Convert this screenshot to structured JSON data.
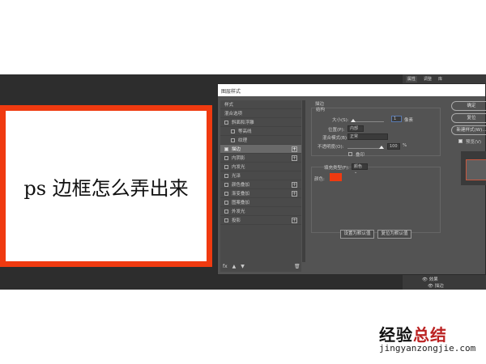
{
  "canvas": {
    "text": "ps 边框怎么弄出来",
    "border_color": "#f03a10"
  },
  "panel_tabs": [
    "属性",
    "调整",
    "库"
  ],
  "dialog": {
    "title": "图层样式",
    "styles": [
      {
        "label": "样式",
        "type": "header"
      },
      {
        "label": "混合选项",
        "type": "header"
      },
      {
        "label": "斜面和浮雕",
        "checked": false
      },
      {
        "label": "等高线",
        "checked": false,
        "sub": true
      },
      {
        "label": "纹理",
        "checked": false,
        "sub": true
      },
      {
        "label": "描边",
        "checked": true,
        "plus": true,
        "selected": true
      },
      {
        "label": "内阴影",
        "checked": false,
        "plus": true
      },
      {
        "label": "内发光",
        "checked": false
      },
      {
        "label": "光泽",
        "checked": false
      },
      {
        "label": "颜色叠加",
        "checked": false,
        "plus": true
      },
      {
        "label": "渐变叠加",
        "checked": false,
        "plus": true
      },
      {
        "label": "图案叠加",
        "checked": false
      },
      {
        "label": "外发光",
        "checked": false
      },
      {
        "label": "投影",
        "checked": false,
        "plus": true
      }
    ],
    "footer_icons": [
      "fx",
      "▲",
      "▼"
    ],
    "stroke": {
      "section": "描边",
      "structure": "结构",
      "size_label": "大小(S):",
      "size_value": "1",
      "size_unit": "像素",
      "size_fraction": 0.02,
      "position_label": "位置(P):",
      "position_value": "内部",
      "blend_label": "混合模式(B):",
      "blend_value": "正常",
      "opacity_label": "不透明度(O):",
      "opacity_value": "100",
      "opacity_unit": "%",
      "opacity_fraction": 1.0,
      "overprint_label": "叠印",
      "fill_type_label": "填充类型(F):",
      "fill_type_value": "颜色",
      "color_label": "颜色:",
      "color": "#f03a10",
      "set_default": "设置为默认值",
      "reset_default": "复位为默认值"
    },
    "buttons": {
      "ok": "确定",
      "reset": "复位",
      "new_style": "新建样式(W)...",
      "preview_label": "预览(V)"
    }
  },
  "layers": {
    "effects": "效果",
    "stroke": "描边"
  },
  "watermark": {
    "a": "经验",
    "b": "总结",
    "url": "jingyanzongjie.com"
  }
}
